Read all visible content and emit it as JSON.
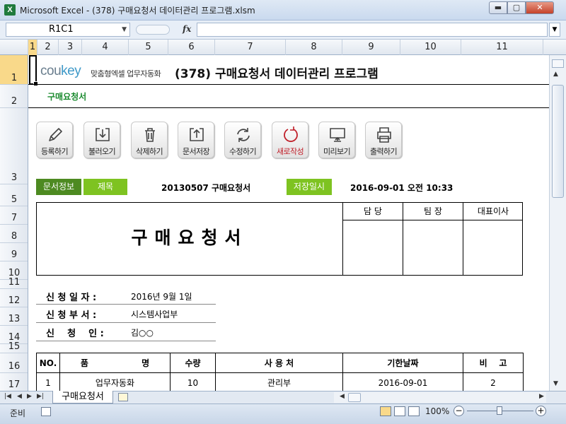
{
  "window": {
    "title": "Microsoft Excel - (378) 구매요청서 데이터관리 프로그램.xlsm",
    "app_icon": "X",
    "min_glyph": "▬",
    "max_glyph": "▢",
    "close_glyph": "✕"
  },
  "formula_bar": {
    "name_box": "R1C1",
    "fx": "fx",
    "formula": ""
  },
  "columns": [
    "1",
    "2",
    "3",
    "4",
    "5",
    "6",
    "7",
    "8",
    "9",
    "10",
    "11"
  ],
  "rows": [
    "1",
    "2",
    "3",
    "5",
    "7",
    "8",
    "9",
    "10",
    "11",
    "12",
    "13",
    "14",
    "15",
    "16",
    "17"
  ],
  "header": {
    "logo_main": "cou",
    "logo_accent": "key",
    "logo_sub": "맞춤형엑셀 업무자동화",
    "title": "(378) 구매요청서 데이터관리 프로그램",
    "subtitle": "구매요청서"
  },
  "toolbar": [
    {
      "label": "등록하기",
      "icon": "pencil-icon"
    },
    {
      "label": "불러오기",
      "icon": "download-icon"
    },
    {
      "label": "삭제하기",
      "icon": "trash-icon"
    },
    {
      "label": "문서저장",
      "icon": "upload-icon"
    },
    {
      "label": "수정하기",
      "icon": "refresh-icon"
    },
    {
      "label": "새로작성",
      "icon": "new-circle-icon"
    },
    {
      "label": "미리보기",
      "icon": "monitor-icon"
    },
    {
      "label": "출력하기",
      "icon": "printer-icon"
    }
  ],
  "info": {
    "doc_info_label": "문서정보",
    "title_label": "제목",
    "doc_title": "20130507 구매요청서",
    "saved_label": "저장일시",
    "saved_value": "2016-09-01  오전 10:33"
  },
  "document": {
    "heading": "구매요청서",
    "approvals": [
      "담 당",
      "팀 장",
      "대표이사"
    ]
  },
  "request": [
    {
      "label": "신 청 일 자 :",
      "value": "2016년 9월 1일"
    },
    {
      "label": "신 청 부 서 :",
      "value": "시스템사업부"
    },
    {
      "label": "신    청    인 :",
      "value": "김○○"
    }
  ],
  "items": {
    "headers": [
      "NO.",
      "품                  명",
      "수량",
      "사 용 처",
      "기한날짜",
      "비    고"
    ],
    "rows": [
      [
        "1",
        "업무자동화",
        "10",
        "관리부",
        "2016-09-01",
        "2"
      ]
    ]
  },
  "sheet_tabs": {
    "active": "구매요청서"
  },
  "status": {
    "ready": "준비",
    "zoom": "100%"
  },
  "colors": {
    "accent_dark_green": "#4d8a21",
    "accent_green": "#7ec321",
    "subtitle_green": "#1a8a2e",
    "logo_blue": "#3f99c8",
    "new_red": "#c0202a"
  }
}
